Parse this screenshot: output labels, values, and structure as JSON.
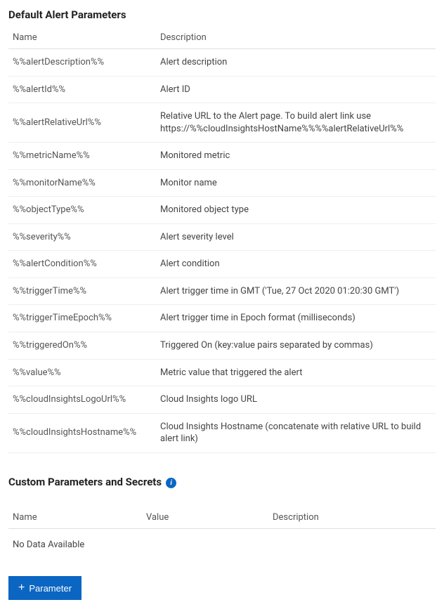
{
  "defaults": {
    "title": "Default Alert Parameters",
    "cols": {
      "name": "Name",
      "desc": "Description"
    },
    "rows": [
      {
        "name": "%%alertDescription%%",
        "desc": "Alert description"
      },
      {
        "name": "%%alertId%%",
        "desc": "Alert ID"
      },
      {
        "name": "%%alertRelativeUrl%%",
        "desc": "Relative URL to the Alert page. To build alert link use https://%%cloudInsightsHostName%%%%alertRelativeUrl%%"
      },
      {
        "name": "%%metricName%%",
        "desc": "Monitored metric"
      },
      {
        "name": "%%monitorName%%",
        "desc": "Monitor name"
      },
      {
        "name": "%%objectType%%",
        "desc": "Monitored object type"
      },
      {
        "name": "%%severity%%",
        "desc": "Alert severity level"
      },
      {
        "name": "%%alertCondition%%",
        "desc": "Alert condition"
      },
      {
        "name": "%%triggerTime%%",
        "desc": "Alert trigger time in GMT ('Tue, 27 Oct 2020 01:20:30 GMT')"
      },
      {
        "name": "%%triggerTimeEpoch%%",
        "desc": "Alert trigger time in Epoch format (milliseconds)"
      },
      {
        "name": "%%triggeredOn%%",
        "desc": "Triggered On (key:value pairs separated by commas)"
      },
      {
        "name": "%%value%%",
        "desc": "Metric value that triggered the alert"
      },
      {
        "name": "%%cloudInsightsLogoUrl%%",
        "desc": "Cloud Insights logo URL"
      },
      {
        "name": "%%cloudInsightsHostname%%",
        "desc": "Cloud Insights Hostname (concatenate with relative URL to build alert link)"
      }
    ]
  },
  "custom": {
    "title": "Custom Parameters and Secrets",
    "cols": {
      "name": "Name",
      "value": "Value",
      "desc": "Description"
    },
    "empty": "No Data Available",
    "add_label": "Parameter"
  }
}
